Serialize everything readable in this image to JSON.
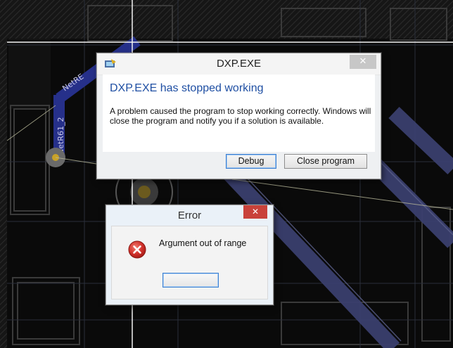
{
  "background": {
    "net_labels": [
      "NetRE",
      "NetR61_2"
    ]
  },
  "crash_dialog": {
    "title": "DXP.EXE",
    "close_glyph": "✕",
    "heading": "DXP.EXE has stopped working",
    "message": "A problem caused the program to stop working correctly. Windows will close the program and notify you if a solution is available.",
    "buttons": {
      "debug": "Debug",
      "close_program": "Close program"
    },
    "accent_color": "#1f4fa3"
  },
  "error_dialog": {
    "title": "Error",
    "close_glyph": "✕",
    "message": "Argument out of range",
    "ok_label": "",
    "icon": "error-icon",
    "close_color": "#c9423a"
  }
}
